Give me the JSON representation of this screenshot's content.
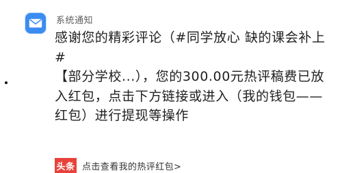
{
  "notification": {
    "sender": "系统通知",
    "icon": "mail-icon",
    "accent_color": "#3b8cf0",
    "message": "感谢您的精彩评论（#同学放心 缺的课会补上#\n【部分学校...），您的300.00元热评稿费已放入红包，点击下方链接或进入（我的钱包——红包）进行提现等操作"
  },
  "link": {
    "brand_label": "头条",
    "brand_color": "#e8423a",
    "text": "点击查看我的热评红包>"
  }
}
